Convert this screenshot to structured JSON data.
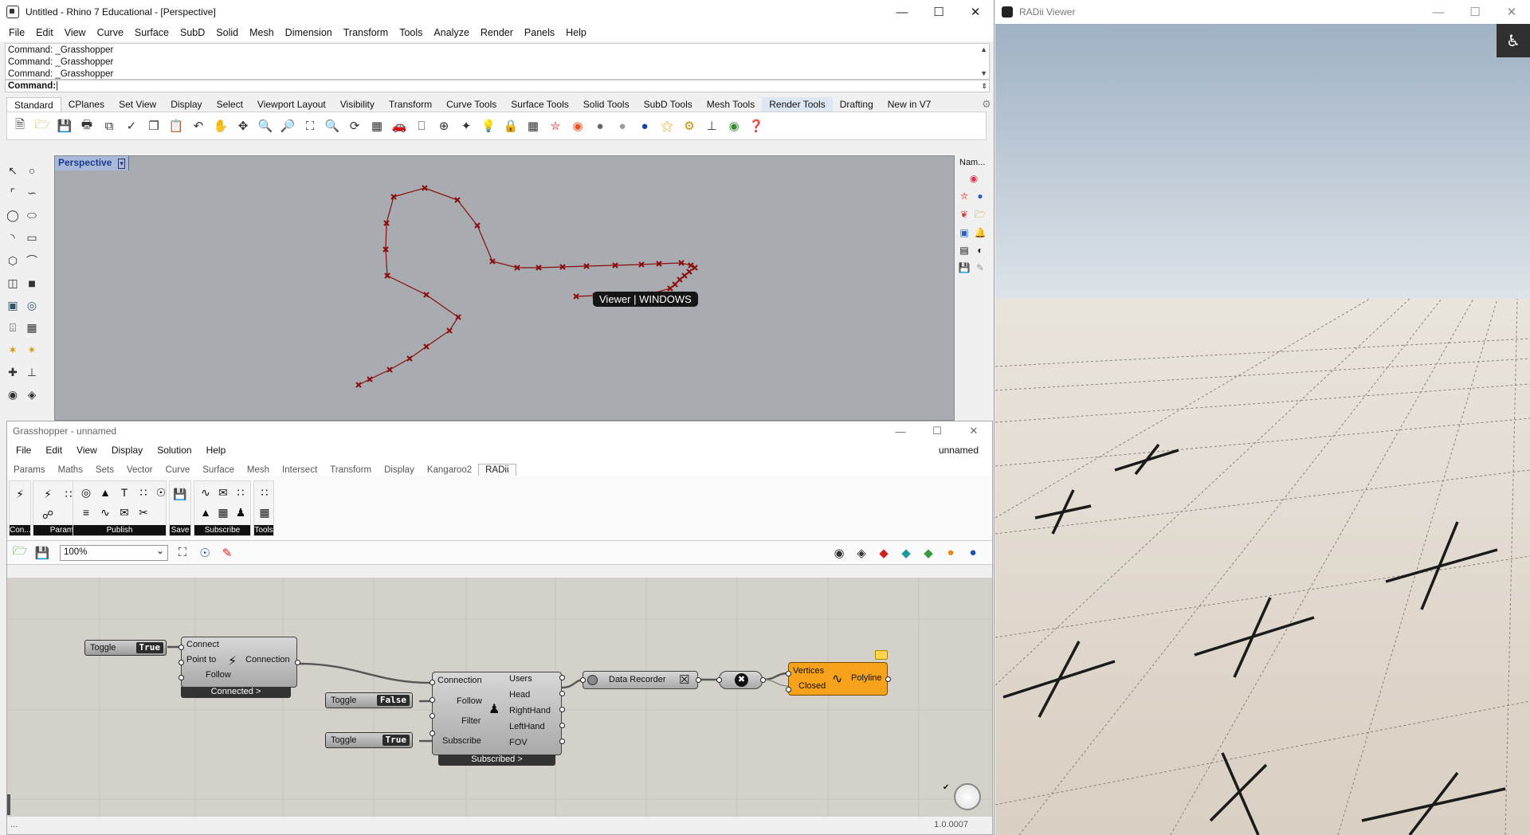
{
  "rhino": {
    "title": "Untitled - Rhino 7 Educational - [Perspective]",
    "menu": [
      "File",
      "Edit",
      "View",
      "Curve",
      "Surface",
      "SubD",
      "Solid",
      "Mesh",
      "Dimension",
      "Transform",
      "Tools",
      "Analyze",
      "Render",
      "Panels",
      "Help"
    ],
    "command_history": [
      "Command: _Grasshopper",
      "Command: _Grasshopper",
      "Command: _Grasshopper"
    ],
    "command_prompt": "Command:",
    "toolbar_tabs": [
      "Standard",
      "CPlanes",
      "Set View",
      "Display",
      "Select",
      "Viewport Layout",
      "Visibility",
      "Transform",
      "Curve Tools",
      "Surface Tools",
      "Solid Tools",
      "SubD Tools",
      "Mesh Tools",
      "Render Tools",
      "Drafting",
      "New in V7"
    ],
    "active_tab": "Standard",
    "viewport_label": "Perspective",
    "viewer_tag": "Viewer | WINDOWS",
    "right_panel_title": "Nam...",
    "curve_color": "#8b0d0d"
  },
  "grasshopper": {
    "title": "Grasshopper - unnamed",
    "menu": [
      "File",
      "Edit",
      "View",
      "Display",
      "Solution",
      "Help"
    ],
    "doc_name": "unnamed",
    "tabs": [
      "Params",
      "Maths",
      "Sets",
      "Vector",
      "Curve",
      "Surface",
      "Mesh",
      "Intersect",
      "Transform",
      "Display",
      "Kangaroo2",
      "RADii"
    ],
    "active_tab": "RADii",
    "ribbon_groups": {
      "con": "Con...",
      "params": "Params",
      "publish": "Publish",
      "save": "Save",
      "subscribe": "Subscribe",
      "tools": "Tools"
    },
    "zoom": "100%",
    "version": "1.0.0007",
    "status_left": "...",
    "nodes": {
      "toggle1": {
        "label": "Toggle",
        "value": "True"
      },
      "toggle2": {
        "label": "Toggle",
        "value": "False"
      },
      "toggle3": {
        "label": "Toggle",
        "value": "True"
      },
      "connect": {
        "inputs": [
          "Connect",
          "Point to",
          "Follow"
        ],
        "output": "Connection",
        "caption": "Connected >"
      },
      "subscribe": {
        "inputs": [
          "Connection",
          "Follow",
          "Filter",
          "Subscribe"
        ],
        "outputs": [
          "Users",
          "Head",
          "RightHand",
          "LeftHand",
          "FOV"
        ],
        "caption": "Subscribed >"
      },
      "recorder": {
        "label": "Data Recorder"
      },
      "polyline": {
        "inputs": [
          "Vertices",
          "Closed"
        ],
        "output": "Polyline",
        "color": "#f7a21b"
      }
    }
  },
  "radii": {
    "title": "RADii Viewer"
  }
}
